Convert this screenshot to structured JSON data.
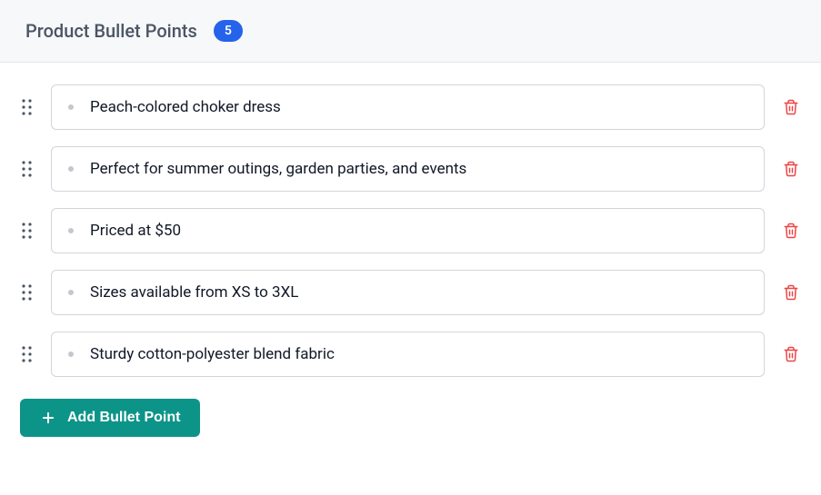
{
  "header": {
    "title": "Product Bullet Points",
    "count": "5"
  },
  "bullets": [
    {
      "text": "Peach-colored choker dress"
    },
    {
      "text": "Perfect for summer outings, garden parties, and events"
    },
    {
      "text": "Priced at $50"
    },
    {
      "text": "Sizes available from XS to 3XL"
    },
    {
      "text": "Sturdy cotton-polyester blend fabric"
    }
  ],
  "add_button_label": "Add Bullet Point"
}
